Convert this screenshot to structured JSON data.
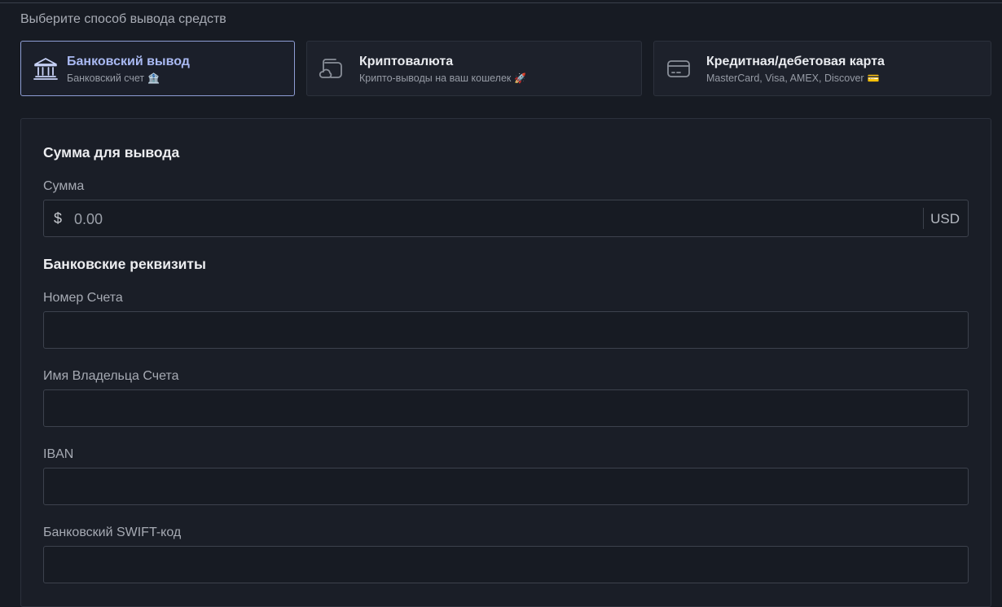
{
  "page": {
    "section_label": "Выберите способ вывода средств"
  },
  "methods": [
    {
      "title": "Банковский вывод",
      "subtitle": "Банковский счет",
      "emoji": "🏦",
      "icon": "bank-icon",
      "active": true
    },
    {
      "title": "Криптовалюта",
      "subtitle": "Крипто-выводы на ваш кошелек",
      "emoji": "🚀",
      "icon": "crypto-wallet-icon",
      "active": false
    },
    {
      "title": "Кредитная/дебетовая карта",
      "subtitle": "MasterCard, Visa, AMEX, Discover",
      "emoji": "💳",
      "icon": "credit-card-icon",
      "active": false
    }
  ],
  "form": {
    "amount_heading": "Сумма для вывода",
    "amount_label": "Сумма",
    "amount_prefix": "$",
    "amount_placeholder": "0.00",
    "amount_currency": "USD",
    "bank_heading": "Банковские реквизиты",
    "account_number_label": "Номер Счета",
    "account_number_value": "",
    "holder_name_label": "Имя Владельца Счета",
    "holder_name_value": "",
    "iban_label": "IBAN",
    "iban_value": "",
    "swift_label": "Банковский SWIFT-код",
    "swift_value": ""
  },
  "colors": {
    "background": "#171b23",
    "card": "#1a1e27",
    "active_accent": "#a9b9f2",
    "active_border": "#8e9dd4"
  }
}
